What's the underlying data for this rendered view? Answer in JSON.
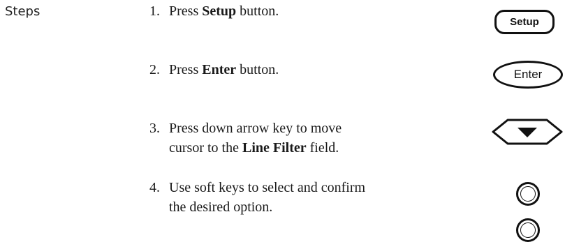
{
  "section": {
    "label": "Steps"
  },
  "steps": [
    {
      "number": "1.",
      "pre": "Press ",
      "bold": "Setup",
      "post": " button."
    },
    {
      "number": "2.",
      "pre": "Press ",
      "bold": "Enter",
      "post": " button."
    },
    {
      "number": "3.",
      "line1": "Press down arrow key to move",
      "pre": "cursor to the ",
      "bold": "Line Filter",
      "post": " field."
    },
    {
      "number": "4.",
      "line1": "Use soft keys to select and confirm",
      "line2": "the desired option."
    }
  ],
  "buttons": {
    "setup_label": "Setup",
    "enter_label": "Enter",
    "down_arrow_icon": "down-arrow-icon",
    "soft_key_icon": "soft-key-icon"
  }
}
